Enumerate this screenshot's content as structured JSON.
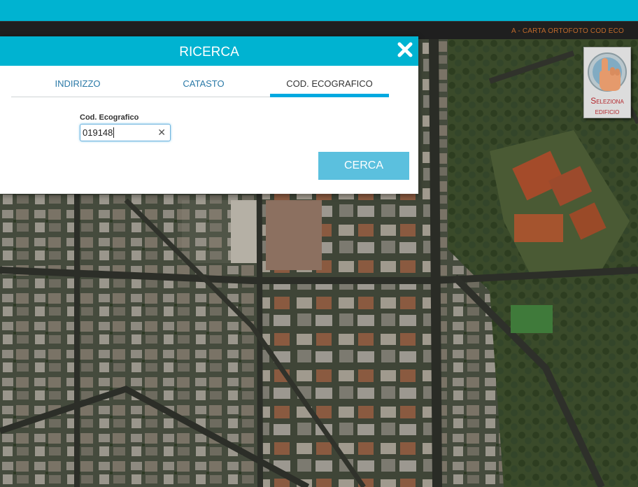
{
  "header": {
    "layer_label": "A - CARTA ORTOFOTO COD ECO"
  },
  "dialog": {
    "title": "RICERCA",
    "tabs": [
      {
        "label": "INDIRIZZO",
        "active": false
      },
      {
        "label": "CATASTO",
        "active": false
      },
      {
        "label": "COD. ECOGRAFICO",
        "active": true
      }
    ],
    "field": {
      "label": "Cod. Ecografico",
      "value": "019148"
    },
    "search_label": "CERCA"
  },
  "select_building": {
    "line1": "Seleziona",
    "line2": "edificio"
  },
  "colors": {
    "accent": "#00b3d1",
    "button": "#5bc0de",
    "tab_underline": "#00a9e0",
    "label_orange": "#c06a2b",
    "select_text": "#b3272d"
  },
  "icons": {
    "close": "close-icon",
    "clear": "clear-input-icon",
    "select": "hand-pointer-icon"
  }
}
